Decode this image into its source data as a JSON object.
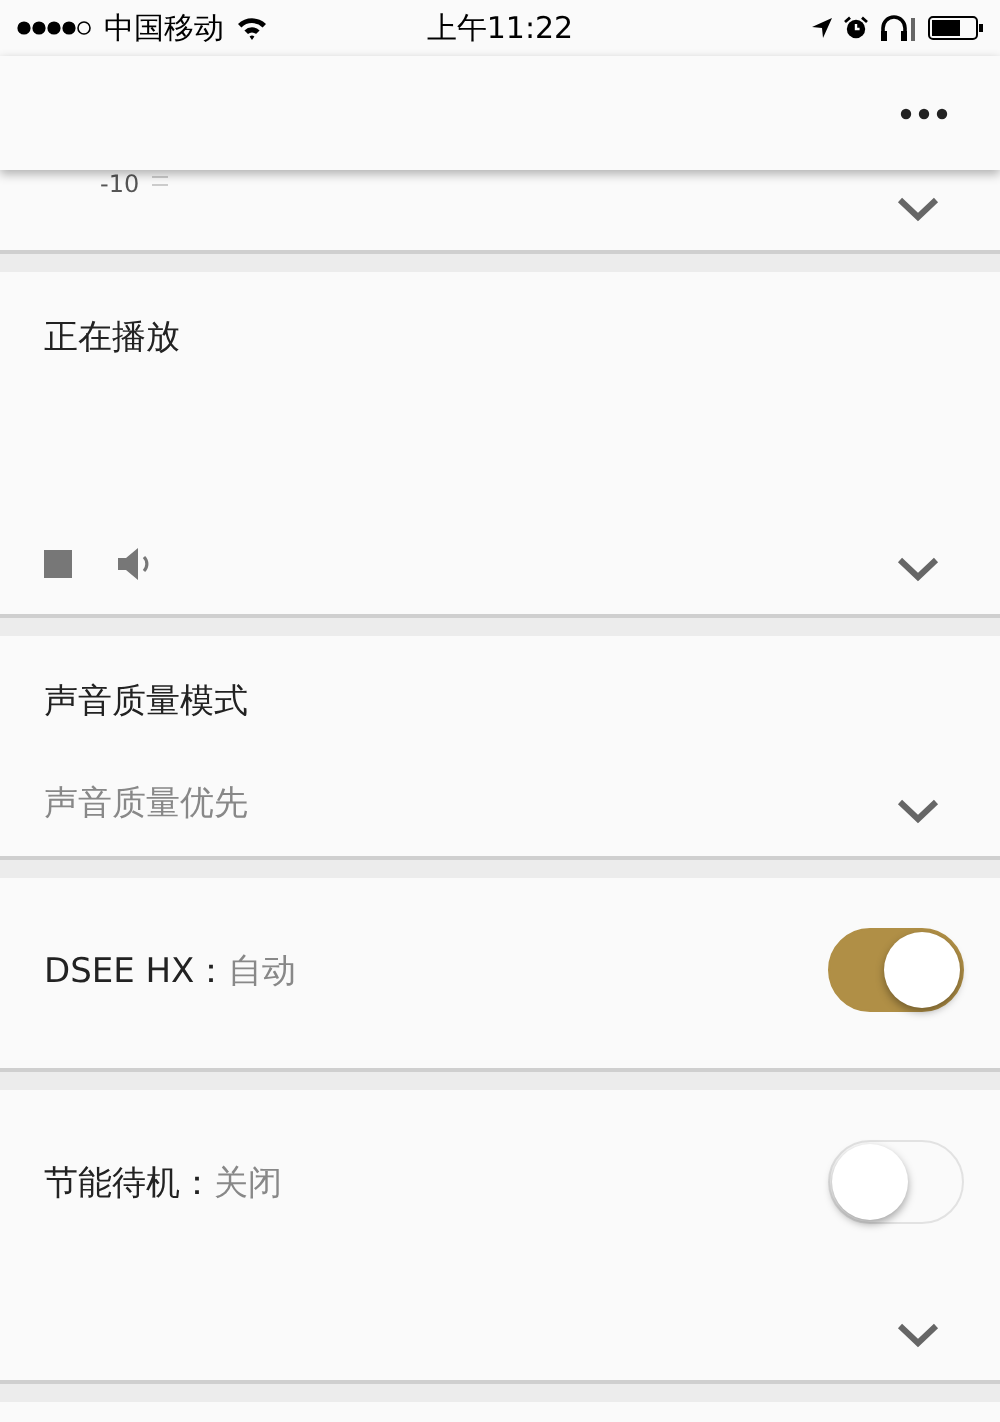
{
  "status_bar": {
    "carrier": "中国移动",
    "time": "上午11:22"
  },
  "cards": [
    {
      "kind": "partial",
      "scale_label": "-10",
      "expandable": true
    },
    {
      "kind": "now_playing",
      "title": "正在播放",
      "expandable": true
    },
    {
      "kind": "select",
      "title": "声音质量模式",
      "value": "声音质量优先",
      "expandable": true
    },
    {
      "kind": "toggle",
      "label": "DSEE HX：",
      "value": "自动",
      "on": true,
      "expandable": false
    },
    {
      "kind": "toggle",
      "label": "节能待机：",
      "value": "关闭",
      "on": false,
      "expandable": true
    }
  ]
}
